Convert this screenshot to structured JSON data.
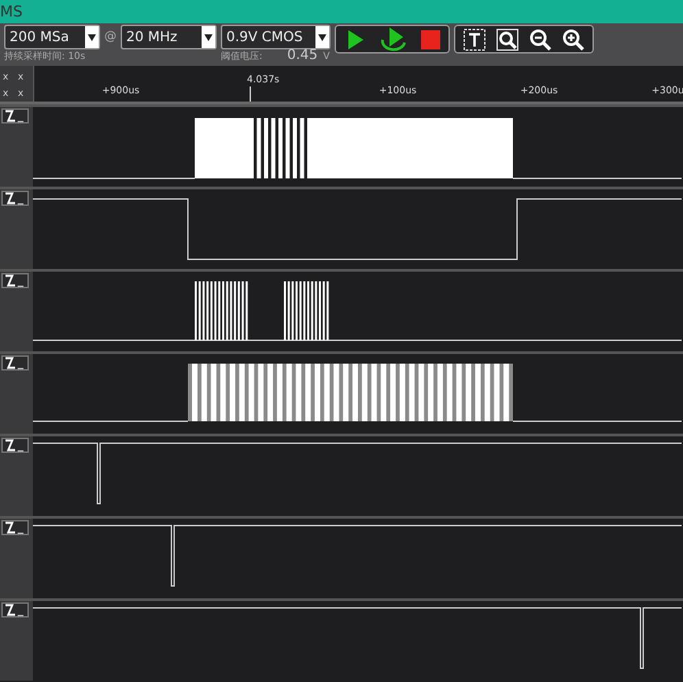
{
  "window": {
    "title": "MS"
  },
  "toolbar": {
    "sample_rate": "200 MSa",
    "at": "@",
    "frequency": "20 MHz",
    "logic_level": "0.9V CMOS",
    "duration_label": "持续采样时间: 10s",
    "threshold_label": "阈值电压:",
    "threshold_value": "0.45",
    "threshold_unit": "V"
  },
  "ruler": {
    "left_marks": [
      "x",
      "x",
      "x",
      "x"
    ],
    "cursor_time": "4.037s",
    "ticks": [
      "+900us",
      "+100us",
      "+200us",
      "+300u"
    ]
  },
  "channels": [
    {
      "trigger": "_"
    },
    {
      "trigger": "_"
    },
    {
      "trigger": "_"
    },
    {
      "trigger": "_"
    },
    {
      "trigger": "_"
    },
    {
      "trigger": "_"
    },
    {
      "trigger": "_"
    }
  ]
}
